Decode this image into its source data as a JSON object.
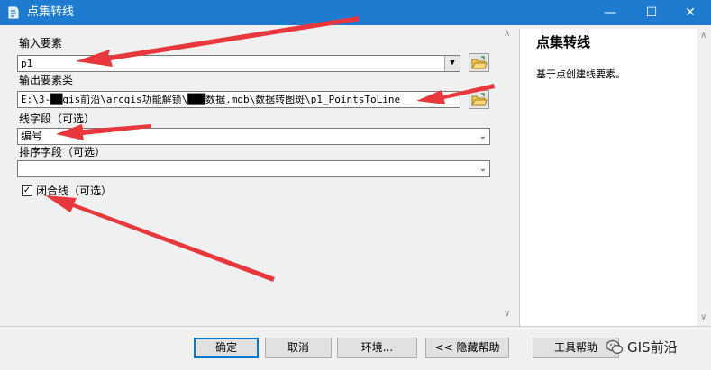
{
  "window": {
    "title": "点集转线",
    "controls": {
      "minimize": "—",
      "maximize": "☐",
      "close": "✕"
    },
    "accent_color": "#1e7bd0"
  },
  "form": {
    "input_features": {
      "label": "输入要素",
      "value": "p1"
    },
    "output_feature_class": {
      "label": "输出要素类",
      "value": "E:\\3-██gis前沿\\arcgis功能解锁\\███数据.mdb\\数据转图斑\\p1_PointsToLine"
    },
    "line_field": {
      "label": "线字段（可选）",
      "value": "编号"
    },
    "sort_field": {
      "label": "排序字段（可选）",
      "value": ""
    },
    "close_line": {
      "label": "闭合线（可选）",
      "checked": true,
      "check_mark": "✓"
    }
  },
  "help": {
    "title": "点集转线",
    "description": "基于点创建线要素。"
  },
  "buttons": {
    "ok": "确定",
    "cancel": "取消",
    "environments": "环境...",
    "hide_help": "<< 隐藏帮助",
    "tool_help": "工具帮助"
  },
  "watermark": {
    "text": "GIS前沿"
  },
  "annotation_color": "#e8383d"
}
